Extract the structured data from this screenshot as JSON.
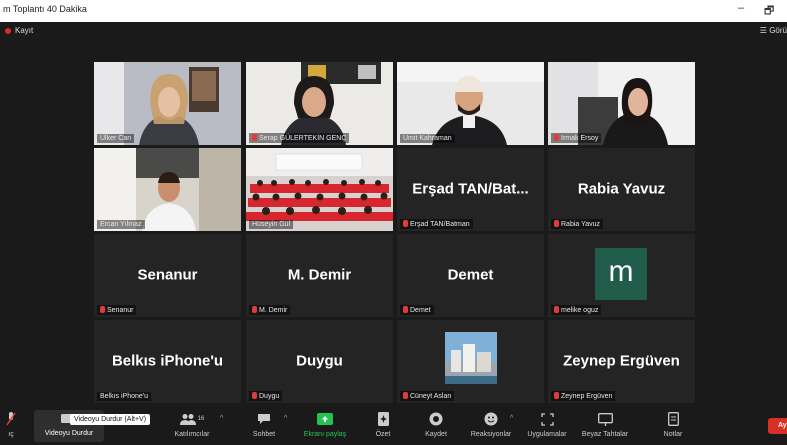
{
  "window": {
    "title": "m Toplantı 40 Dakika",
    "minimize": "–",
    "maximize": "🗗"
  },
  "topbar": {
    "record_label": "Kayıt",
    "view_label": "Görü"
  },
  "tiles": [
    {
      "name": "Ülker Can"
    },
    {
      "name": "Serap GÜLERTEKİN GENÇ"
    },
    {
      "name": "Ümit Kahraman"
    },
    {
      "name": "Irmak Ersoy"
    },
    {
      "name": "Ercan Yılmaz"
    },
    {
      "name": "Hüseyin Gül"
    },
    {
      "big": "Erşad TAN/Bat...",
      "name": "Erşad TAN/Batman"
    },
    {
      "big": "Rabia Yavuz",
      "name": "Rabia Yavuz"
    },
    {
      "big": "Senanur",
      "name": "Senanur"
    },
    {
      "big": "M. Demir",
      "name": "M. Demir"
    },
    {
      "big": "Demet",
      "name": "Demet"
    },
    {
      "avatar_letter": "m",
      "name": "melike oguz"
    },
    {
      "big": "Belkıs iPhone'u",
      "name": "Belkıs iPhone'u"
    },
    {
      "big": "Duygu",
      "name": "Duygu"
    },
    {
      "name": "Cüneyt Aslan"
    },
    {
      "big": "Zeynep Ergüven",
      "name": "Zeynep Ergüven"
    }
  ],
  "toolbar": {
    "mute_label": "ıç",
    "video_label": "Videoyu Durdur",
    "video_tooltip": "Videoyu Durdur (Alt+V)",
    "participants_label": "Katılımcılar",
    "participants_count": "16",
    "chat_label": "Sohbet",
    "share_label": "Ekranı paylaş",
    "summary_label": "Özet",
    "record_label": "Kaydet",
    "reactions_label": "Reaksiyonlar",
    "apps_label": "Uygulamalar",
    "whiteboard_label": "Beyaz Tahtalar",
    "notes_label": "Notlar",
    "leave_label": "Ay"
  },
  "colors": {
    "active_border": "#c8d23a",
    "record_dot": "#e02828",
    "share_green": "#23c552",
    "avatar_bg": "#1f5c4a",
    "leave_red": "#d93025"
  }
}
